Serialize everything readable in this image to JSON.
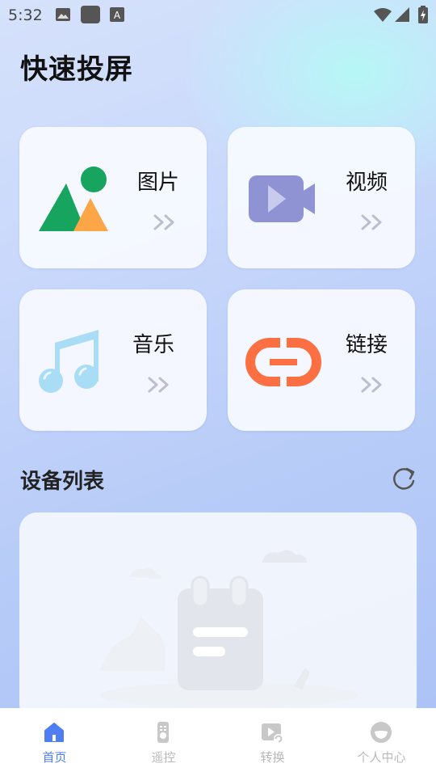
{
  "status_bar": {
    "time": "5:32"
  },
  "page_title": "快速投屏",
  "cards": [
    {
      "label": "图片"
    },
    {
      "label": "视频"
    },
    {
      "label": "音乐"
    },
    {
      "label": "链接"
    }
  ],
  "devices": {
    "title": "设备列表"
  },
  "tabs": [
    {
      "label": "首页",
      "icon": "home-icon",
      "active": true
    },
    {
      "label": "遥控",
      "icon": "remote-icon",
      "active": false
    },
    {
      "label": "转换",
      "icon": "convert-icon",
      "active": false
    },
    {
      "label": "个人中心",
      "icon": "profile-icon",
      "active": false
    }
  ],
  "colors": {
    "accent": "#4f7ef2",
    "tab_inactive": "#b8b8b8",
    "picture_green": "#16a45f",
    "picture_orange": "#fda648",
    "video_purple": "#8f93d4",
    "music_blue": "#a9dcf5",
    "link_orange": "#fb6f42"
  }
}
